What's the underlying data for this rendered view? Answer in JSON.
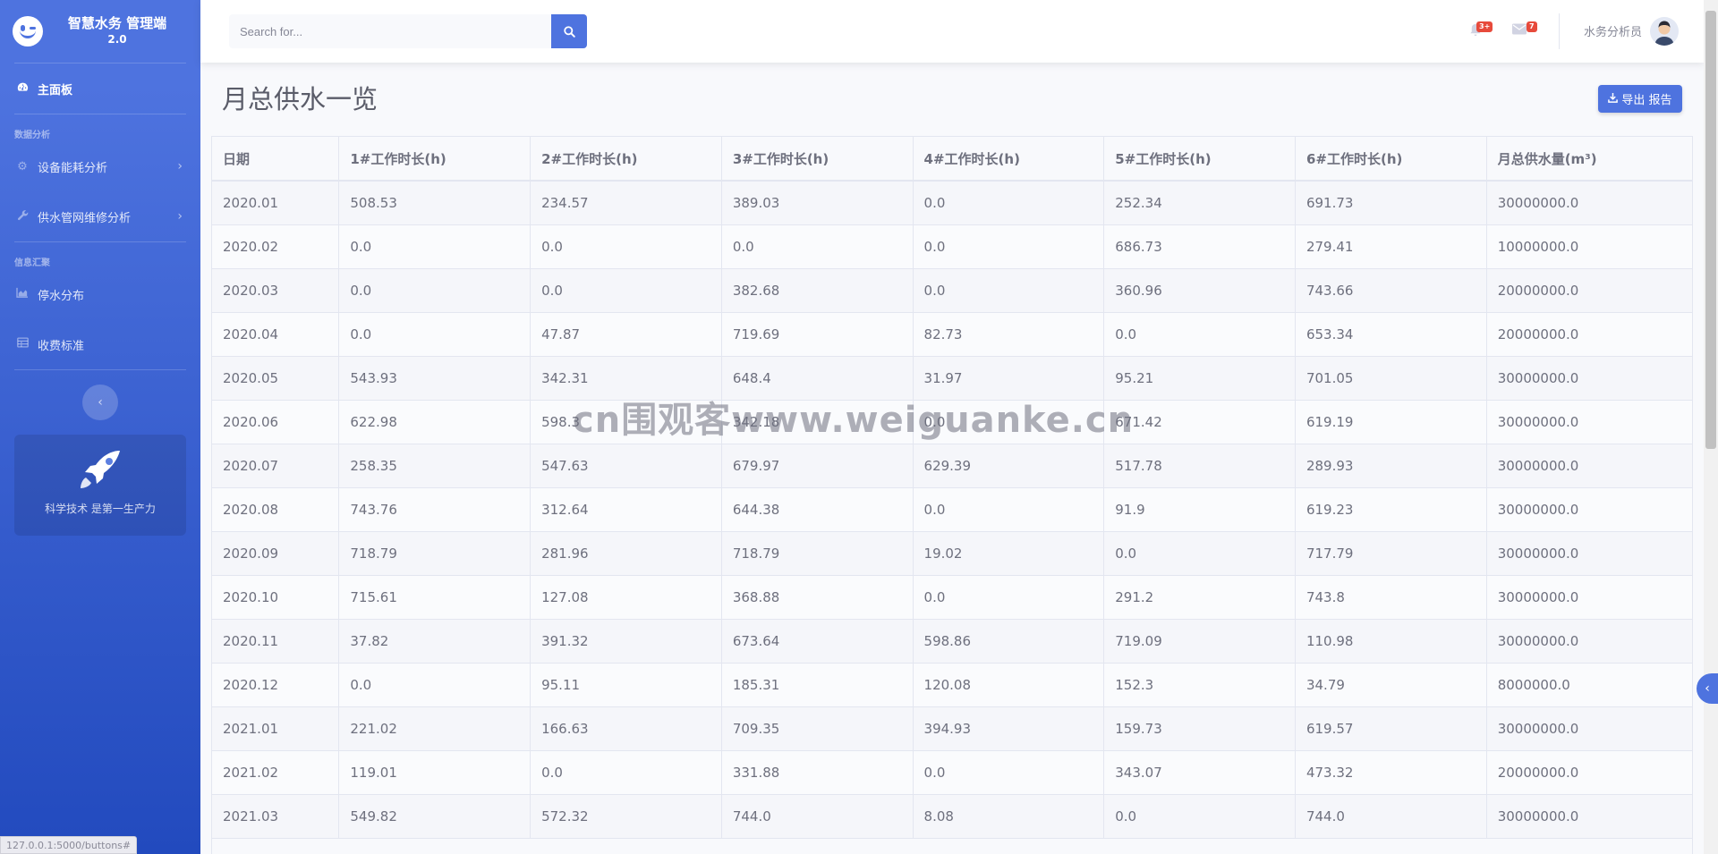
{
  "brand": {
    "name": "智慧水务 管理端",
    "version": "2.0"
  },
  "sidebar": {
    "dashboard": "主面板",
    "heading_analysis": "数据分析",
    "device_energy": "设备能耗分析",
    "pipe_repair": "供水管网维修分析",
    "heading_info": "信息汇聚",
    "outage": "停水分布",
    "fee": "收费标准",
    "promo_text": "科学技术 是第一生产力"
  },
  "topbar": {
    "search_placeholder": "Search for...",
    "alerts_badge": "3+",
    "messages_badge": "7",
    "username": "水务分析员"
  },
  "page": {
    "title": "月总供水一览",
    "export_label": "导出 报告"
  },
  "table": {
    "headers": [
      "日期",
      "1#工作时长(h)",
      "2#工作时长(h)",
      "3#工作时长(h)",
      "4#工作时长(h)",
      "5#工作时长(h)",
      "6#工作时长(h)",
      "月总供水量(m³)"
    ],
    "rows": [
      [
        "2020.01",
        "508.53",
        "234.57",
        "389.03",
        "0.0",
        "252.34",
        "691.73",
        "30000000.0"
      ],
      [
        "2020.02",
        "0.0",
        "0.0",
        "0.0",
        "0.0",
        "686.73",
        "279.41",
        "10000000.0"
      ],
      [
        "2020.03",
        "0.0",
        "0.0",
        "382.68",
        "0.0",
        "360.96",
        "743.66",
        "20000000.0"
      ],
      [
        "2020.04",
        "0.0",
        "47.87",
        "719.69",
        "82.73",
        "0.0",
        "653.34",
        "20000000.0"
      ],
      [
        "2020.05",
        "543.93",
        "342.31",
        "648.4",
        "31.97",
        "95.21",
        "701.05",
        "30000000.0"
      ],
      [
        "2020.06",
        "622.98",
        "598.3",
        "342.18",
        "0.0",
        "671.42",
        "619.19",
        "30000000.0"
      ],
      [
        "2020.07",
        "258.35",
        "547.63",
        "679.97",
        "629.39",
        "517.78",
        "289.93",
        "30000000.0"
      ],
      [
        "2020.08",
        "743.76",
        "312.64",
        "644.38",
        "0.0",
        "91.9",
        "619.23",
        "30000000.0"
      ],
      [
        "2020.09",
        "718.79",
        "281.96",
        "718.79",
        "19.02",
        "0.0",
        "717.79",
        "30000000.0"
      ],
      [
        "2020.10",
        "715.61",
        "127.08",
        "368.88",
        "0.0",
        "291.2",
        "743.8",
        "30000000.0"
      ],
      [
        "2020.11",
        "37.82",
        "391.32",
        "673.64",
        "598.86",
        "719.09",
        "110.98",
        "30000000.0"
      ],
      [
        "2020.12",
        "0.0",
        "95.11",
        "185.31",
        "120.08",
        "152.3",
        "34.79",
        "8000000.0"
      ],
      [
        "2021.01",
        "221.02",
        "166.63",
        "709.35",
        "394.93",
        "159.73",
        "619.57",
        "30000000.0"
      ],
      [
        "2021.02",
        "119.01",
        "0.0",
        "331.88",
        "0.0",
        "343.07",
        "473.32",
        "20000000.0"
      ],
      [
        "2021.03",
        "549.82",
        "572.32",
        "744.0",
        "8.08",
        "0.0",
        "744.0",
        "30000000.0"
      ]
    ]
  },
  "watermark": "cn围观客www.weiguanke.cn",
  "statusbar": "127.0.0.1:5000/buttons#"
}
